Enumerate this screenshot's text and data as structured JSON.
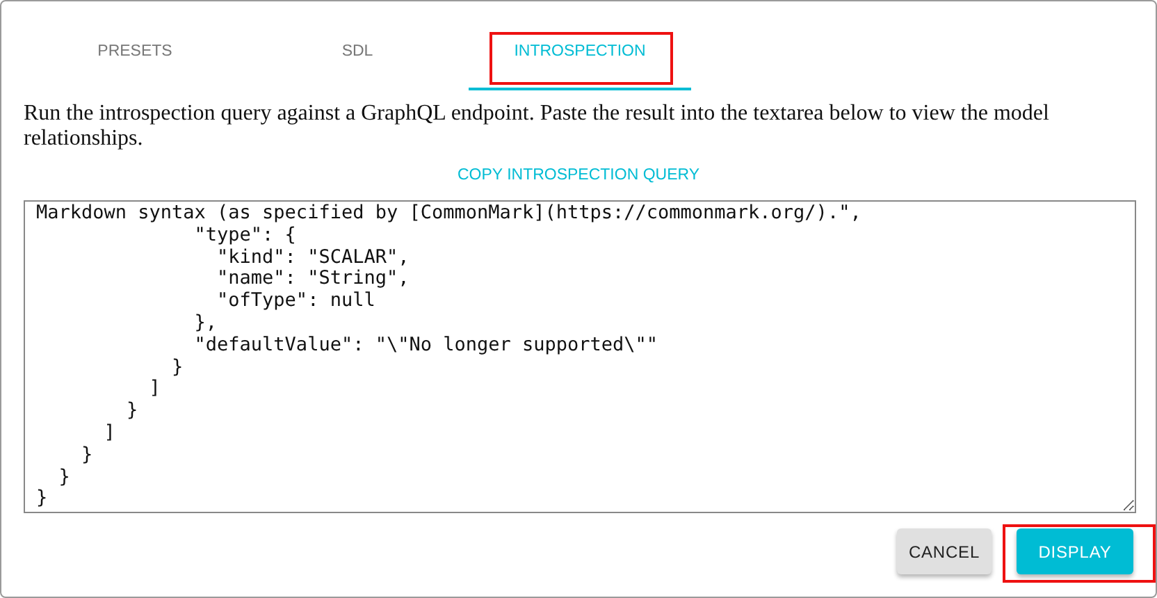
{
  "tabs": [
    {
      "label": "PRESETS",
      "selected": false,
      "highlighted": false
    },
    {
      "label": "SDL",
      "selected": false,
      "highlighted": false
    },
    {
      "label": "INTROSPECTION",
      "selected": true,
      "highlighted": true
    }
  ],
  "instructions": "Run the introspection query against a GraphQL endpoint. Paste the result into the textarea below to view the model relationships.",
  "copy_link": "COPY INTROSPECTION QUERY",
  "textarea": {
    "value": "Markdown syntax (as specified by [CommonMark](https://commonmark.org/).\",\n              \"type\": {\n                \"kind\": \"SCALAR\",\n                \"name\": \"String\",\n                \"ofType\": null\n              },\n              \"defaultValue\": \"\\\"No longer supported\\\"\"\n            }\n          ]\n        }\n      ]\n    }\n  }\n}"
  },
  "buttons": [
    {
      "label": "CANCEL",
      "kind": "secondary",
      "highlighted": false
    },
    {
      "label": "DISPLAY",
      "kind": "primary",
      "highlighted": true
    }
  ]
}
